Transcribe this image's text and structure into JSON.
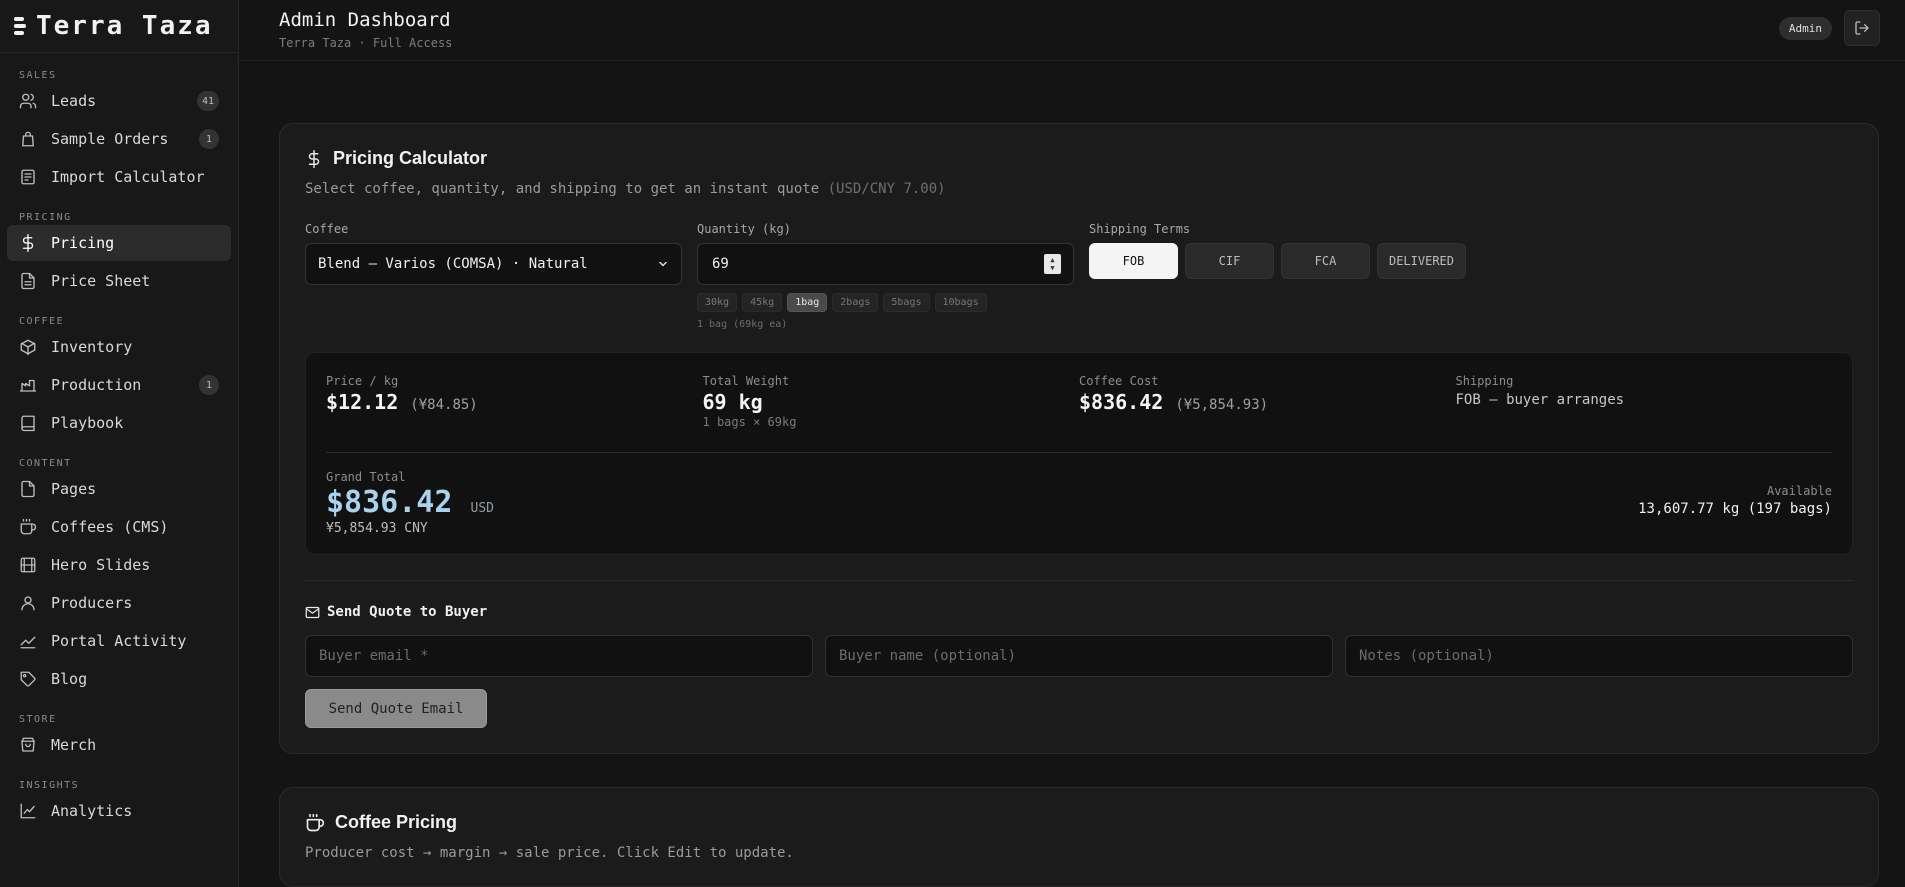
{
  "brand": {
    "name": "Terra Taza"
  },
  "topbar": {
    "title": "Admin Dashboard",
    "subtitle": "Terra Taza · Full Access",
    "role": "Admin"
  },
  "sidebar": {
    "sections": [
      {
        "title": "SALES",
        "items": [
          {
            "label": "Leads",
            "icon": "users-icon",
            "badge": "41"
          },
          {
            "label": "Sample Orders",
            "icon": "shopping-bag-icon",
            "badge": "1"
          },
          {
            "label": "Import Calculator",
            "icon": "calculator-icon"
          }
        ]
      },
      {
        "title": "PRICING",
        "items": [
          {
            "label": "Pricing",
            "icon": "dollar-icon",
            "active": true
          },
          {
            "label": "Price Sheet",
            "icon": "file-text-icon"
          }
        ]
      },
      {
        "title": "COFFEE",
        "items": [
          {
            "label": "Inventory",
            "icon": "package-icon"
          },
          {
            "label": "Production",
            "icon": "factory-icon",
            "badge": "1"
          },
          {
            "label": "Playbook",
            "icon": "book-icon"
          }
        ]
      },
      {
        "title": "CONTENT",
        "items": [
          {
            "label": "Pages",
            "icon": "file-icon"
          },
          {
            "label": "Coffees (CMS)",
            "icon": "coffee-icon"
          },
          {
            "label": "Hero Slides",
            "icon": "film-icon"
          },
          {
            "label": "Producers",
            "icon": "user-icon"
          },
          {
            "label": "Portal Activity",
            "icon": "activity-icon"
          },
          {
            "label": "Blog",
            "icon": "tag-icon"
          }
        ]
      },
      {
        "title": "STORE",
        "items": [
          {
            "label": "Merch",
            "icon": "store-icon"
          }
        ]
      },
      {
        "title": "INSIGHTS",
        "items": [
          {
            "label": "Analytics",
            "icon": "chart-icon"
          }
        ]
      }
    ]
  },
  "pricing_calculator": {
    "title": "Pricing Calculator",
    "description": "Select coffee, quantity, and shipping to get an instant quote",
    "rate_note": "(USD/CNY 7.00)",
    "coffee_label": "Coffee",
    "coffee_value": "Blend — Varios (COMSA) · Natural",
    "quantity_label": "Quantity (kg)",
    "quantity_value": "69",
    "presets": [
      "30kg",
      "45kg",
      "1bag",
      "2bags",
      "5bags",
      "10bags"
    ],
    "active_preset": "1bag",
    "quantity_hint": "1 bag (69kg ea)",
    "shipping_label": "Shipping Terms",
    "shipping_terms": [
      "FOB",
      "CIF",
      "FCA",
      "DELIVERED"
    ],
    "active_term": "FOB",
    "summary": {
      "price_per_kg_label": "Price / kg",
      "price_per_kg": "$12.12",
      "price_per_kg_cny": "(¥84.85)",
      "total_weight_label": "Total Weight",
      "total_weight": "69 kg",
      "total_weight_detail": "1 bags × 69kg",
      "coffee_cost_label": "Coffee Cost",
      "coffee_cost": "$836.42",
      "coffee_cost_cny": "(¥5,854.93)",
      "shipping_label": "Shipping",
      "shipping_value": "FOB — buyer arranges",
      "grand_total_label": "Grand Total",
      "grand_total": "$836.42",
      "grand_total_currency": "USD",
      "grand_total_cny": "¥5,854.93 CNY",
      "available_label": "Available",
      "available_value": "13,607.77 kg (197 bags)"
    },
    "quote": {
      "title": "Send Quote to Buyer",
      "email_placeholder": "Buyer email *",
      "name_placeholder": "Buyer name (optional)",
      "notes_placeholder": "Notes (optional)",
      "send_label": "Send Quote Email"
    }
  },
  "coffee_pricing": {
    "title": "Coffee Pricing",
    "description": "Producer cost → margin → sale price. Click Edit to update."
  }
}
